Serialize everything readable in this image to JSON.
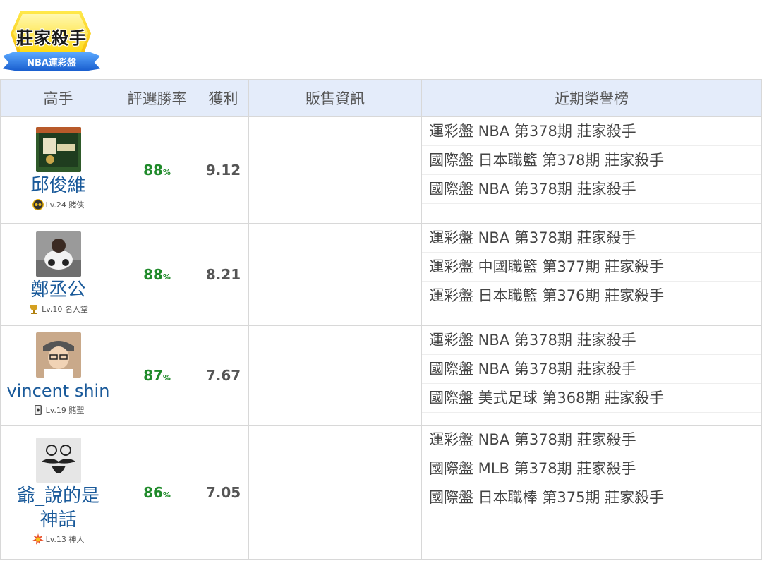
{
  "logo": {
    "title": "莊家殺手",
    "subtitle": "NBA運彩盤"
  },
  "table": {
    "headers": [
      "高手",
      "評選勝率",
      "獲利",
      "販售資訊",
      "近期榮譽榜"
    ],
    "rows": [
      {
        "name": "邱俊維",
        "level": "Lv.24 賭俠",
        "level_icon": "eye-mask-icon",
        "win_rate": "88",
        "pct": "%",
        "profit": "9.12",
        "sale": "",
        "honors": [
          "運彩盤 NBA 第378期 莊家殺手",
          "國際盤 日本職籃 第378期 莊家殺手",
          "國際盤 NBA 第378期 莊家殺手"
        ]
      },
      {
        "name": "鄭丞公",
        "level": "Lv.10 名人堂",
        "level_icon": "trophy-icon",
        "win_rate": "88",
        "pct": "%",
        "profit": "8.21",
        "sale": "",
        "honors": [
          "運彩盤 NBA 第378期 莊家殺手",
          "運彩盤 中國職籃 第377期 莊家殺手",
          "運彩盤 日本職籃 第376期 莊家殺手"
        ]
      },
      {
        "name": "vincent shin",
        "level": "Lv.19 賭聖",
        "level_icon": "card-icon",
        "win_rate": "87",
        "pct": "%",
        "profit": "7.67",
        "sale": "",
        "honors": [
          "運彩盤 NBA 第378期 莊家殺手",
          "國際盤 NBA 第378期 莊家殺手",
          "國際盤 美式足球 第368期 莊家殺手"
        ]
      },
      {
        "name": "爺_說的是神話",
        "level": "Lv.13 神人",
        "level_icon": "starburst-icon",
        "win_rate": "86",
        "pct": "%",
        "profit": "7.05",
        "sale": "",
        "honors": [
          "運彩盤 NBA 第378期 莊家殺手",
          "國際盤 MLB 第378期 莊家殺手",
          "國際盤 日本職棒 第375期 莊家殺手"
        ]
      }
    ]
  },
  "colors": {
    "header_bg": "#e4ecfa",
    "name": "#1a5a9a",
    "win_rate": "#1f8a2a"
  }
}
